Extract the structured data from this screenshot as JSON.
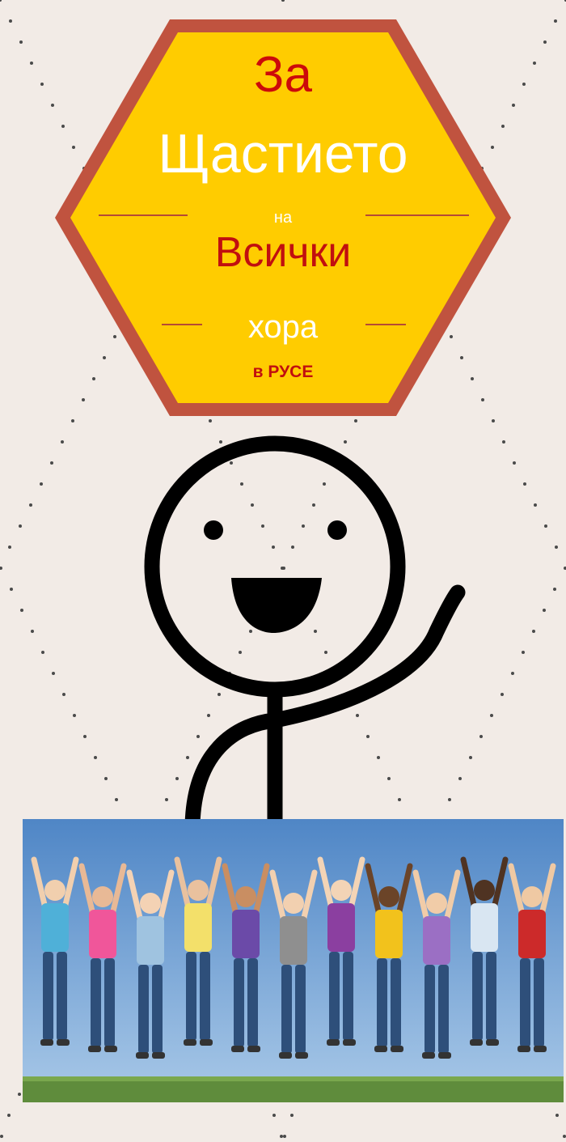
{
  "poster": {
    "line_za": "За",
    "line_happiness": "Щастието",
    "line_na": "на",
    "line_all": "Всички",
    "line_people": "хора",
    "line_city": "в РУСЕ"
  },
  "colors": {
    "background": "#f2ebe6",
    "hexagon_fill": "#ffcc00",
    "hexagon_border": "#c0533f",
    "accent_red": "#cc0a0a",
    "text_white": "#ffffff",
    "sky": "#6a9fd3",
    "grass": "#5f8c3c"
  },
  "icons": {
    "figure": "waving-stick-figure",
    "photo": "jumping-people-photo"
  }
}
